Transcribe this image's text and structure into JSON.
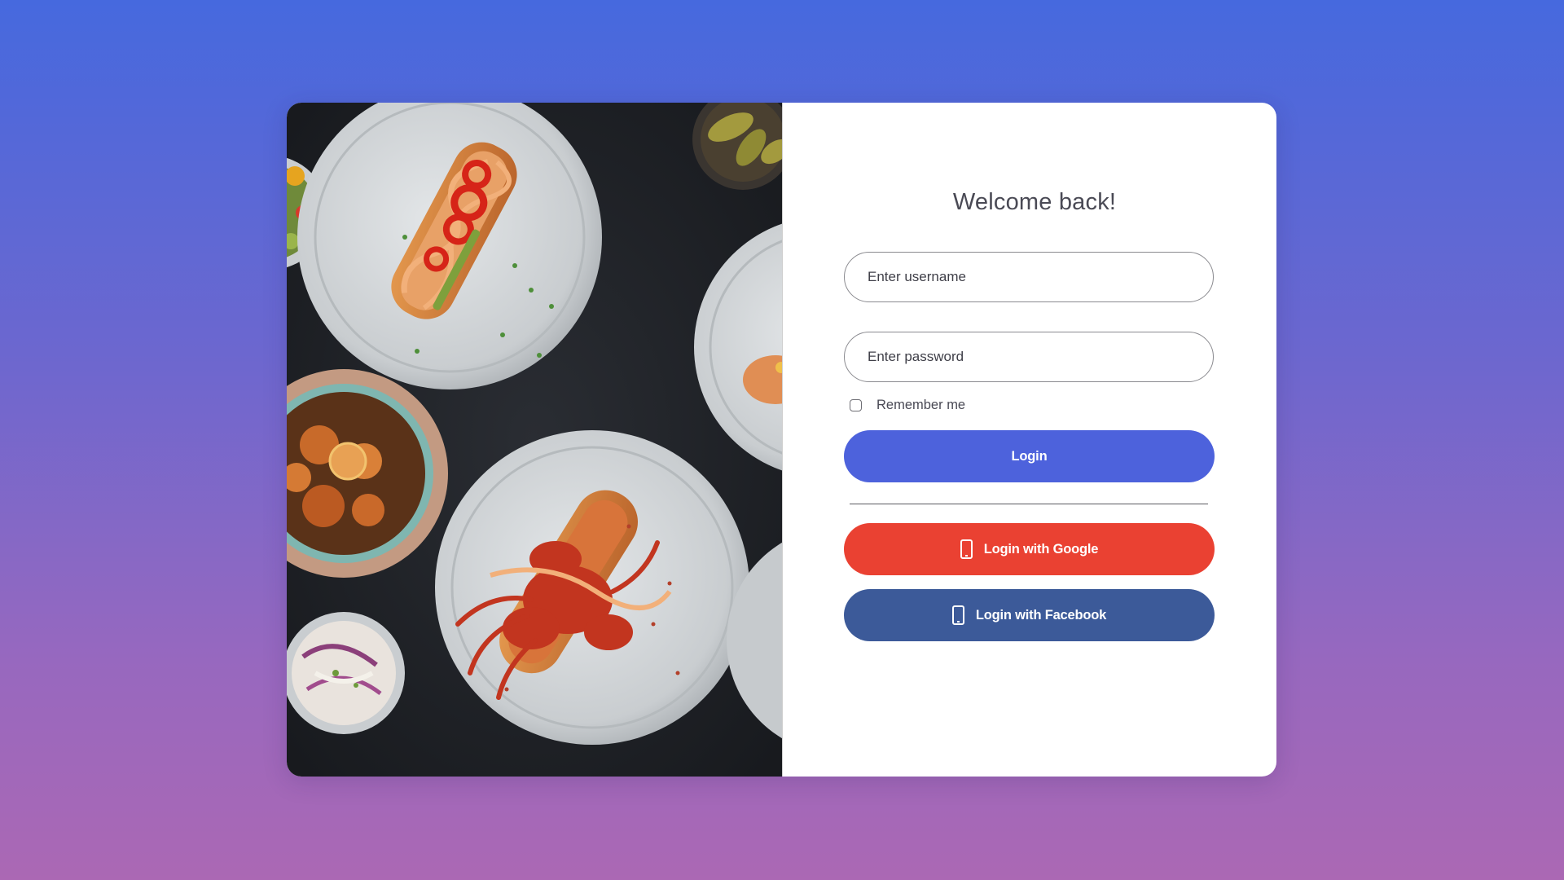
{
  "login_card": {
    "hero_image": {
      "description_icon": "food-plates-photo"
    },
    "form": {
      "welcome_title": "Welcome back!",
      "username": {
        "placeholder": "Enter username",
        "value": ""
      },
      "password": {
        "placeholder": "Enter password",
        "value": ""
      },
      "remember_me": {
        "label": "Remember me",
        "checked": false
      },
      "login_button": {
        "label": "Login",
        "color": "#4d62dc"
      },
      "google_button": {
        "label": "Login with Google",
        "icon": "mobile-phone-icon",
        "color": "#ea4132"
      },
      "facebook_button": {
        "label": "Login with Facebook",
        "icon": "mobile-phone-icon",
        "color": "#3c5a99"
      }
    }
  },
  "colors": {
    "background_top": "#4669de",
    "background_bottom": "#ab68b4",
    "card_background": "#ffffff"
  }
}
